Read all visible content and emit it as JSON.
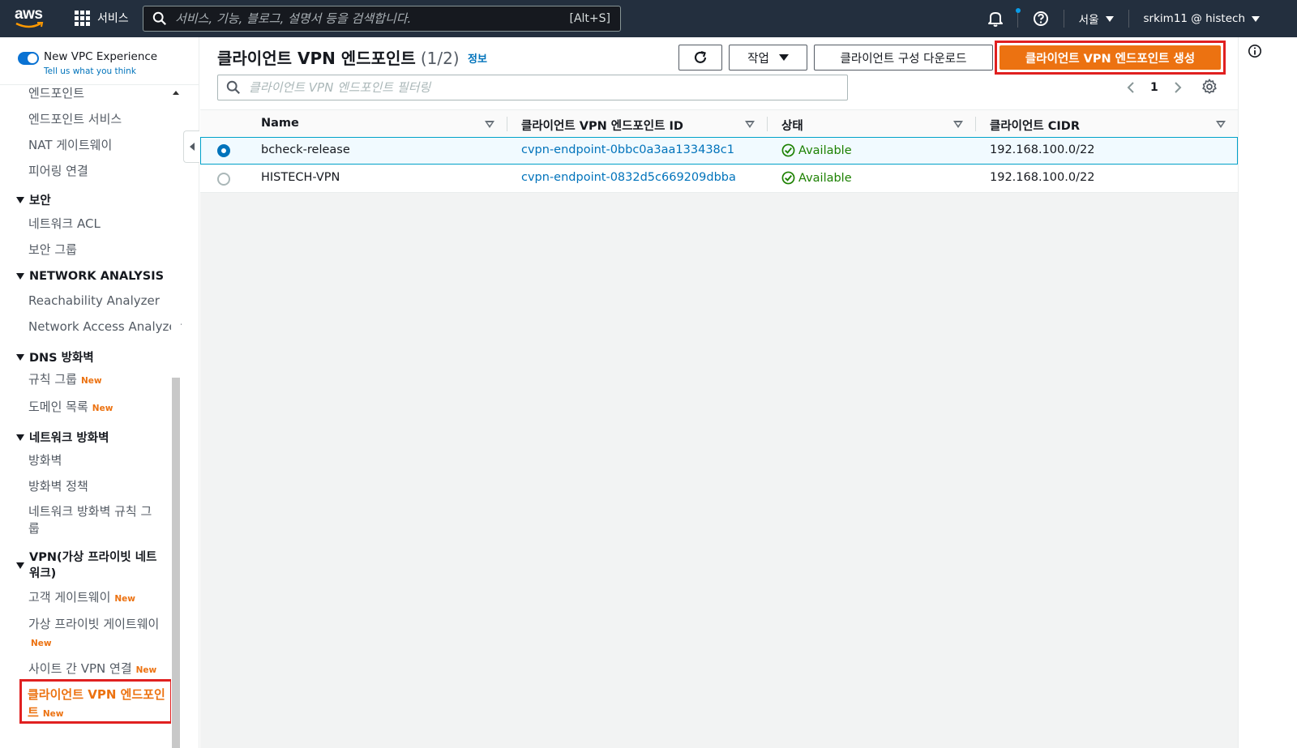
{
  "topnav": {
    "logo_text": "aws",
    "services_label": "서비스",
    "search_placeholder": "서비스, 기능, 블로그, 설명서 등을 검색합니다.",
    "search_shortcut": "[Alt+S]",
    "region_label": "서울",
    "account_label": "srkim11 @ histech"
  },
  "sidebar": {
    "vpc_experience_title": "New VPC Experience",
    "vpc_experience_sub": "Tell us what you think",
    "new_badge": "New",
    "items": {
      "endpoints": "엔드포인트",
      "endpoint_services": "엔드포인트 서비스",
      "nat_gateways": "NAT 게이트웨이",
      "peering": "피어링 연결",
      "security_head": "보안",
      "network_acl": "네트워크 ACL",
      "security_groups": "보안 그룹",
      "network_analysis_head": "NETWORK ANALYSIS",
      "reachability": "Reachability Analyzer",
      "network_access": "Network Access Analyzer",
      "dns_firewall_head": "DNS 방화벽",
      "rule_groups": "규칙 그룹",
      "domain_lists": "도메인 목록",
      "network_firewall_head": "네트워크 방화벽",
      "firewalls": "방화벽",
      "firewall_policies": "방화벽 정책",
      "nfw_rule_groups_1": "네트워크 방화벽 규칙 그",
      "nfw_rule_groups_2": "룹",
      "vpn_head_1": "VPN(가상 프라이빗 네트",
      "vpn_head_2": "워크)",
      "customer_gateways": "고객 게이트웨이",
      "virtual_private_gateways": "가상 프라이빗 게이트웨이",
      "site_to_site": "사이트 간 VPN 연결",
      "client_vpn_1": "클라이언트 VPN 엔드포인",
      "client_vpn_2": "트"
    }
  },
  "main": {
    "title": "클라이언트 VPN 엔드포인트",
    "count": "(1/2)",
    "info_link": "정보",
    "actions_label": "작업",
    "download_label": "클라이언트 구성 다운로드",
    "create_label": "클라이언트 VPN 엔드포인트 생성",
    "filter_placeholder": "클라이언트 VPN 엔드포인트 필터링",
    "page_number": "1",
    "columns": [
      "Name",
      "클라이언트 VPN 엔드포인트 ID",
      "상태",
      "클라이언트 CIDR"
    ],
    "rows": [
      {
        "name": "bcheck-release",
        "id": "cvpn-endpoint-0bbc0a3aa133438c1",
        "status": "Available",
        "cidr": "192.168.100.0/22"
      },
      {
        "name": "HISTECH-VPN",
        "id": "cvpn-endpoint-0832d5c669209dbba",
        "status": "Available",
        "cidr": "192.168.100.0/22"
      }
    ]
  },
  "colors": {
    "nav_bg": "#232f3e",
    "primary": "#ec7211",
    "link": "#0073bb",
    "success": "#1d8102",
    "highlight_box": "#e02020"
  }
}
